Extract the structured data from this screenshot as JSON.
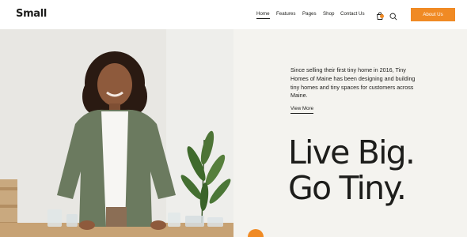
{
  "header": {
    "logo": "Small",
    "nav": [
      {
        "label": "Home",
        "active": true
      },
      {
        "label": "Features",
        "active": false
      },
      {
        "label": "Pages",
        "active": false
      },
      {
        "label": "Shop",
        "active": false
      },
      {
        "label": "Contact Us",
        "active": false
      }
    ],
    "icons": [
      "cart-icon",
      "search-icon"
    ],
    "cta_label": "About Us"
  },
  "hero": {
    "intro": "Since selling their first tiny home in 2016, Tiny Homes of Maine has been designing and building tiny homes and tiny spaces for customers across Maine.",
    "view_more": "View More",
    "headline_line1": "Live Big.",
    "headline_line2": "Go Tiny.",
    "image": "smiling woman in green shirt standing at a table with glassware, plant in background"
  },
  "colors": {
    "accent": "#f08a24",
    "text": "#1d1d1b",
    "panel_bg": "#f4f3ef"
  }
}
